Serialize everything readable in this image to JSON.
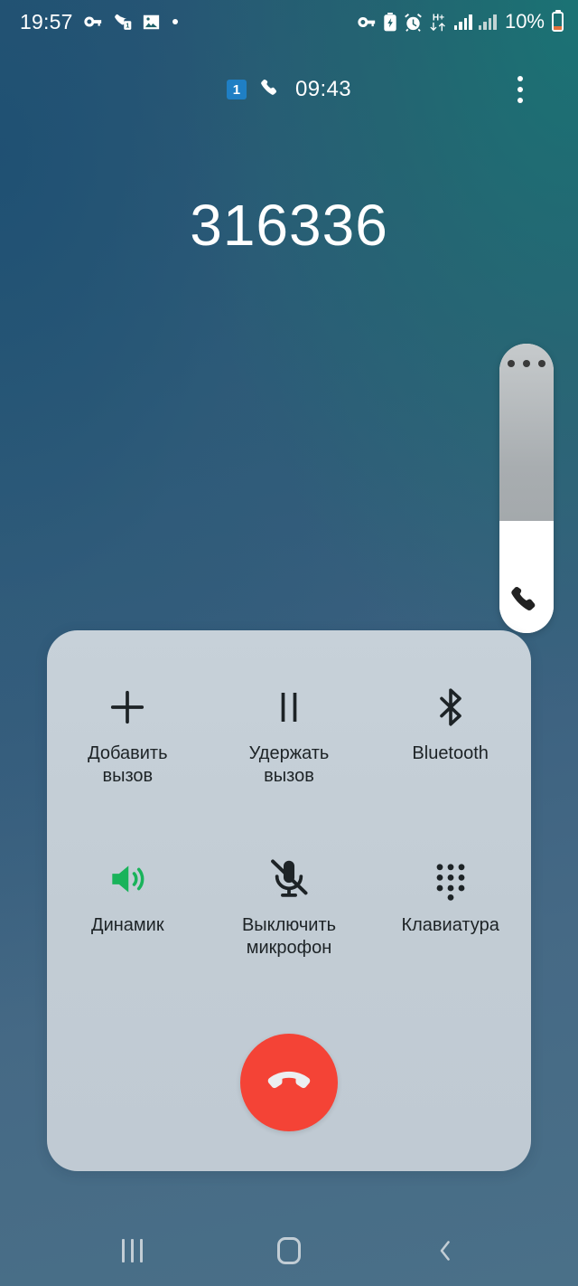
{
  "status_bar": {
    "time": "19:57",
    "battery_percent": "10%",
    "left_icons": [
      "vpn-key-icon",
      "missed-call-icon",
      "image-icon",
      "dot-indicator-icon"
    ],
    "right_icons": [
      "vpn-key-icon",
      "battery-saver-icon",
      "alarm-icon",
      "hplus-data-icon",
      "signal-sim1-icon",
      "signal-sim2-icon"
    ],
    "colors": {
      "text": "#ffffff",
      "battery_fill": "#e2703a"
    }
  },
  "call_header": {
    "sim_badge": "1",
    "phone_icon": "phone-handset-icon",
    "duration": "09:43",
    "menu_icon": "overflow-menu-icon"
  },
  "call": {
    "number": "316336"
  },
  "edge_handle": {
    "dots_icon": "more-dots-icon",
    "phone_icon": "phone-handset-icon"
  },
  "controls": {
    "buttons": [
      {
        "id": "add-call",
        "icon": "plus-icon",
        "label": "Добавить\nвызов",
        "active": false
      },
      {
        "id": "hold-call",
        "icon": "pause-icon",
        "label": "Удержать\nвызов",
        "active": false
      },
      {
        "id": "bluetooth",
        "icon": "bluetooth-icon",
        "label": "Bluetooth",
        "active": false
      },
      {
        "id": "speaker",
        "icon": "speaker-icon",
        "label": "Динамик",
        "active": true
      },
      {
        "id": "mute",
        "icon": "mic-off-icon",
        "label": "Выключить\nмикрофон",
        "active": false
      },
      {
        "id": "keypad",
        "icon": "dialpad-icon",
        "label": "Клавиатура",
        "active": false
      }
    ],
    "end_call": {
      "icon": "end-call-icon",
      "color": "#f44336"
    },
    "active_color": "#19b35a",
    "panel_color": "#c3ced6"
  },
  "navbar": {
    "recents_icon": "recents-icon",
    "home_icon": "home-icon",
    "back_icon": "back-icon"
  }
}
